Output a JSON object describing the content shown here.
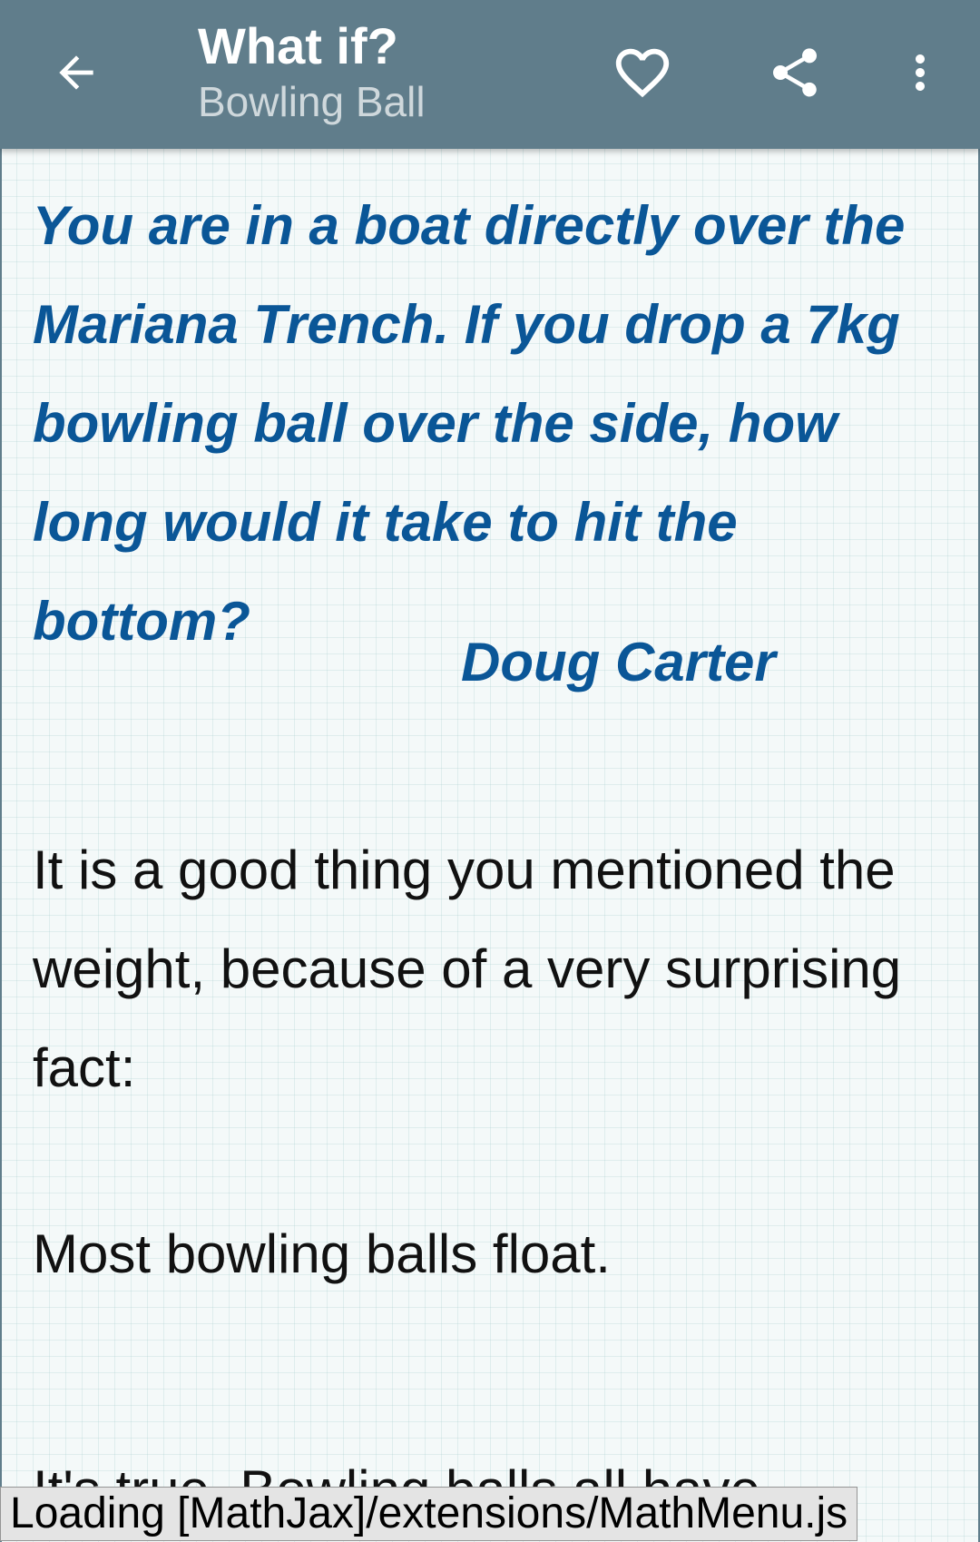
{
  "toolbar": {
    "title": "What if?",
    "subtitle": "Bowling Ball",
    "icons": {
      "back": "arrow-back-icon",
      "favorite": "heart-outline-icon",
      "share": "share-icon",
      "more": "more-vert-icon"
    }
  },
  "article": {
    "question": "You are in a boat directly over the Mariana Trench. If you drop a 7kg bowling ball over the side, how long would it take to hit the bottom?",
    "author": "Doug Carter",
    "paragraphs": [
      "It is a good thing you mentioned the weight, because of a very surprising fact:",
      "Most bowling balls float.",
      "It's true. Bowling balls all have"
    ]
  },
  "status": {
    "loading_text": "Loading [MathJax]/extensions/MathMenu.js"
  },
  "colors": {
    "toolbar_bg": "#607d8b",
    "question_text": "#0a5697",
    "body_text": "#111111"
  }
}
